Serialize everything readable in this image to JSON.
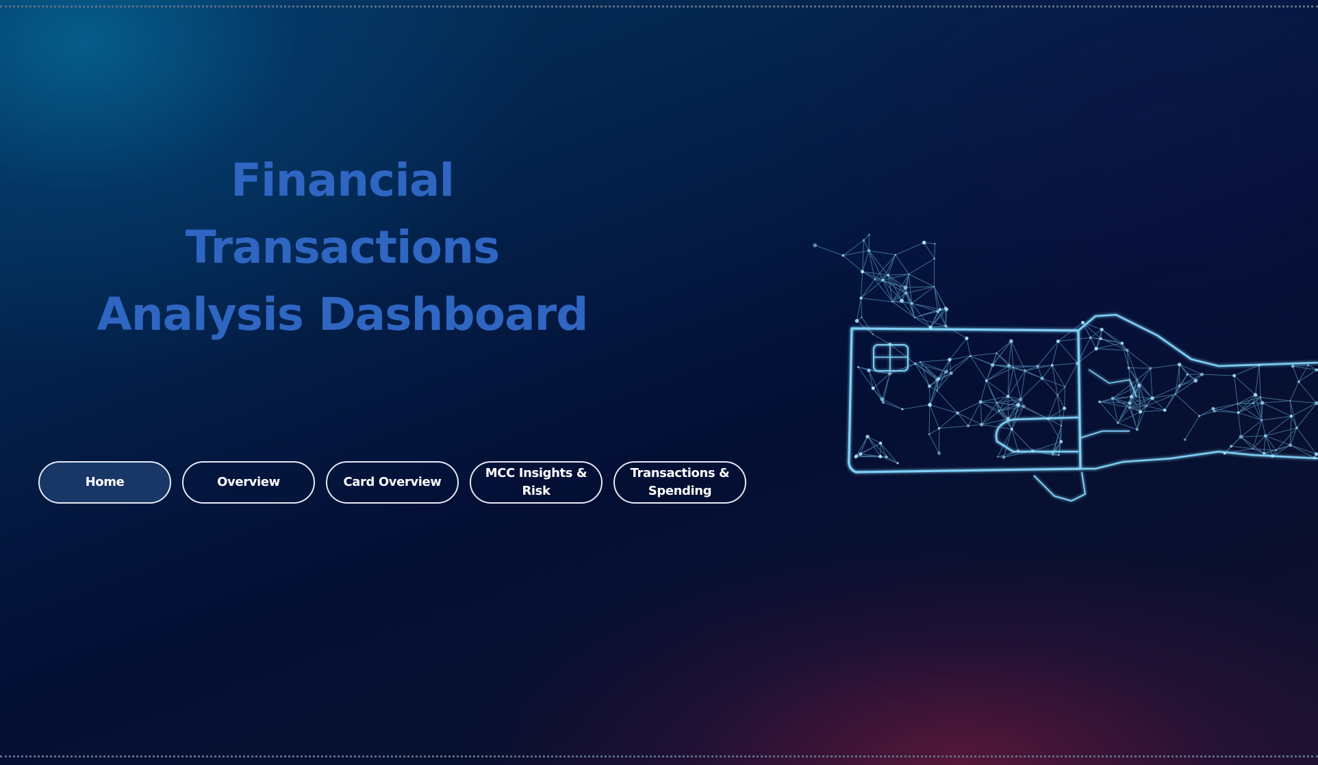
{
  "title": "Financial Transactions\nAnalysis Dashboard",
  "nav": {
    "items": [
      {
        "label": "Home",
        "active": true
      },
      {
        "label": "Overview",
        "active": false
      },
      {
        "label": "Card Overview",
        "active": false
      },
      {
        "label": "MCC Insights & Risk",
        "active": false
      },
      {
        "label": "Transactions &\nSpending",
        "active": false
      }
    ]
  },
  "illustration": {
    "icon": "credit-card-hand-network-icon",
    "color": "#7cc9ef"
  },
  "colors": {
    "title": "#2f66c2",
    "button_active_bg": "#183766",
    "button_border": "#e6ecf5"
  }
}
